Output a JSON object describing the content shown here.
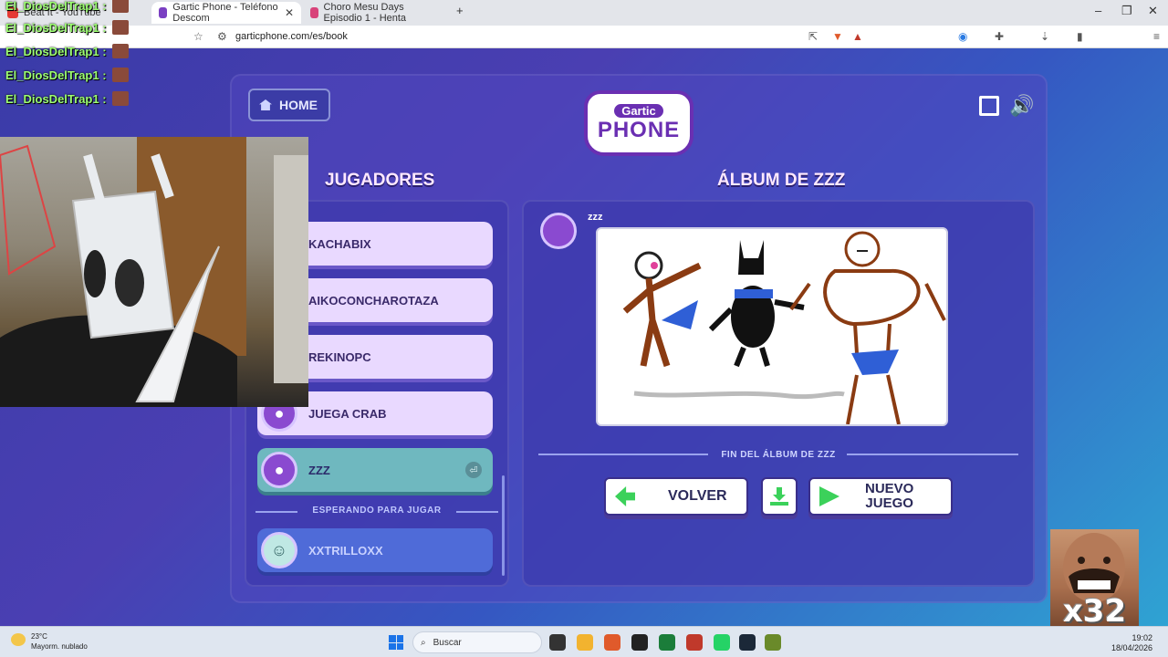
{
  "browser": {
    "tabs": [
      {
        "label": "Beat It - YouTube",
        "active": false
      },
      {
        "label": "Gartic Phone - Teléfono Descom",
        "active": true
      },
      {
        "label": "Choro Mesu Days Episodio 1 - Henta",
        "active": false
      }
    ],
    "new_tab": "+",
    "url": "garticphone.com/es/book",
    "window_controls": [
      "–",
      "❐",
      "✕"
    ]
  },
  "stream_chat": {
    "messages": [
      {
        "user": "El_DiosDelTrap1 :"
      },
      {
        "user": "El_DiosDelTrap1 :"
      },
      {
        "user": "El_DiosDelTrap1 :"
      },
      {
        "user": "El_DiosDelTrap1 :"
      },
      {
        "user": "El_DiosDelTrap1 :"
      }
    ]
  },
  "game": {
    "home_label": "HOME",
    "logo_top": "Gartic",
    "logo_bottom": "PHONE",
    "players_heading": "JUGADORES",
    "album_heading": "ÁLBUM DE ZZZ",
    "players": [
      {
        "name": "KACHABIX"
      },
      {
        "name": "AIKOCONCHAROTAZA"
      },
      {
        "name": "REKINOPC"
      },
      {
        "name": "JUEGA CRAB"
      },
      {
        "name": "ZZZ",
        "current": true
      }
    ],
    "waiting_label": "ESPERANDO PARA JUGAR",
    "waiting_players": [
      {
        "name": "XXTRILLOXX"
      }
    ],
    "album_user": "zzz",
    "end_label": "FIN DEL ÁLBUM DE ZZZ",
    "back_label": "VOLVER",
    "new_game_line1": "NUEVO",
    "new_game_line2": "JUEGO"
  },
  "reaction_overlay": {
    "count": "x32"
  },
  "taskbar": {
    "temperature": "23°C",
    "weather": "Mayorm. nublado",
    "search_placeholder": "Buscar",
    "time": "19:02",
    "date": "18/04/2026"
  },
  "colors": {
    "accent_green": "#3bd15a",
    "chat_green": "#9dff72",
    "panel": "#3c37aa"
  }
}
